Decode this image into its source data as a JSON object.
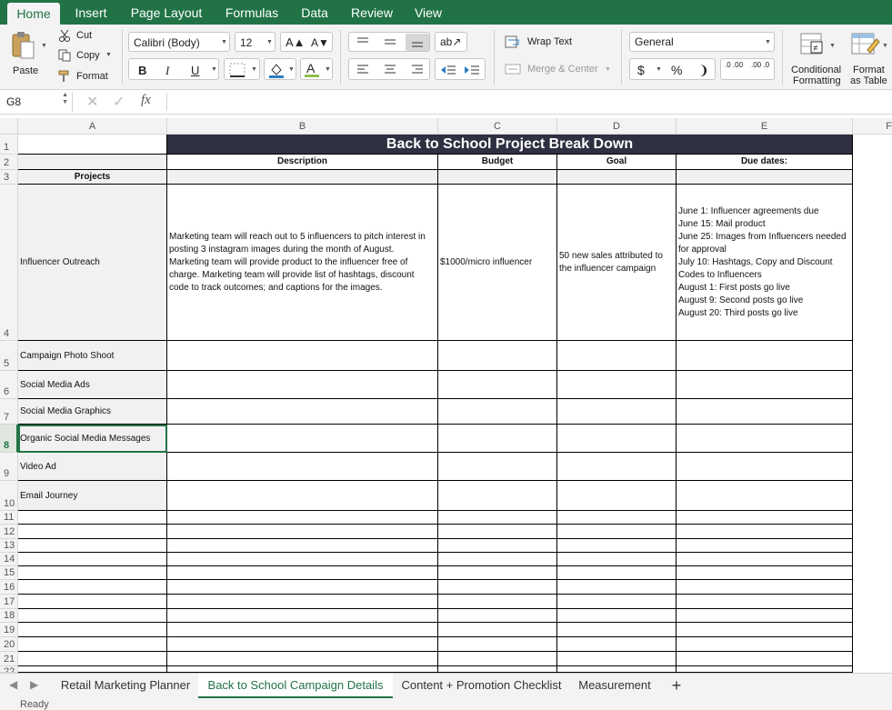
{
  "ribbon_tabs": [
    "Home",
    "Insert",
    "Page Layout",
    "Formulas",
    "Data",
    "Review",
    "View"
  ],
  "clipboard": {
    "paste": "Paste",
    "cut": "Cut",
    "copy": "Copy",
    "format": "Format"
  },
  "font": {
    "name": "Calibri (Body)",
    "size": "12",
    "bold": "B",
    "italic": "I",
    "underline": "U"
  },
  "alignment": {
    "wrap_text": "Wrap Text",
    "merge_center": "Merge & Center"
  },
  "number": {
    "format": "General",
    "currency": "$",
    "percent": "%",
    "comma": "❩",
    "inc_decimal": ".0 .00",
    "dec_decimal": ".00 .0"
  },
  "styles": {
    "conditional_1": "Conditional",
    "conditional_2": "Formatting",
    "table_1": "Format",
    "table_2": "as Table"
  },
  "formula_bar": {
    "name_box": "G8",
    "fx": "fx",
    "value": ""
  },
  "columns": [
    "A",
    "B",
    "C",
    "D",
    "E",
    "F"
  ],
  "rows": [
    "1",
    "2",
    "3",
    "4",
    "5",
    "6",
    "7",
    "8",
    "9",
    "10",
    "11",
    "12",
    "13",
    "14",
    "15",
    "16",
    "17",
    "18",
    "19",
    "20",
    "21",
    "22"
  ],
  "sheet": {
    "title": "Back to School Project Break Down",
    "headers": {
      "description": "Description",
      "budget": "Budget",
      "goal": "Goal",
      "due_dates": "Due dates:",
      "projects": "Projects"
    },
    "projects": [
      {
        "name": "Influencer Outreach",
        "description": "Marketing team will reach out to 5 influencers to pitch interest in posting 3 instagram images during the month of August. Marketing team will provide product to the influencer free of charge. Marketing team will provide list of hashtags, discount code to track outcomes; and captions for the images.",
        "budget": "$1000/micro influencer",
        "goal": "50 new sales attributed to the influencer campaign",
        "due_dates": [
          "June 1: Influencer agreements due",
          "June 15: Mail product",
          "June 25: Images from Influencers needed for approval",
          "July 10: Hashtags, Copy and Discount Codes to Influencers",
          "August 1: First posts go live",
          "August 9: Second posts go live",
          "August 20: Third posts go live"
        ]
      },
      {
        "name": "Campaign Photo Shoot"
      },
      {
        "name": "Social Media Ads"
      },
      {
        "name": "Social Media Graphics"
      },
      {
        "name": "Organic Social Media Messages"
      },
      {
        "name": "Video Ad"
      },
      {
        "name": "Email Journey"
      }
    ]
  },
  "sheet_tabs": [
    "Retail Marketing Planner",
    "Back to School Campaign Details",
    "Content + Promotion Checklist",
    "Measurement"
  ],
  "active_sheet": "Back to School Campaign Details",
  "add_sheet": "+",
  "status": "Ready",
  "colors": {
    "ribbon_green": "#217346",
    "title_bar": "#303043"
  }
}
